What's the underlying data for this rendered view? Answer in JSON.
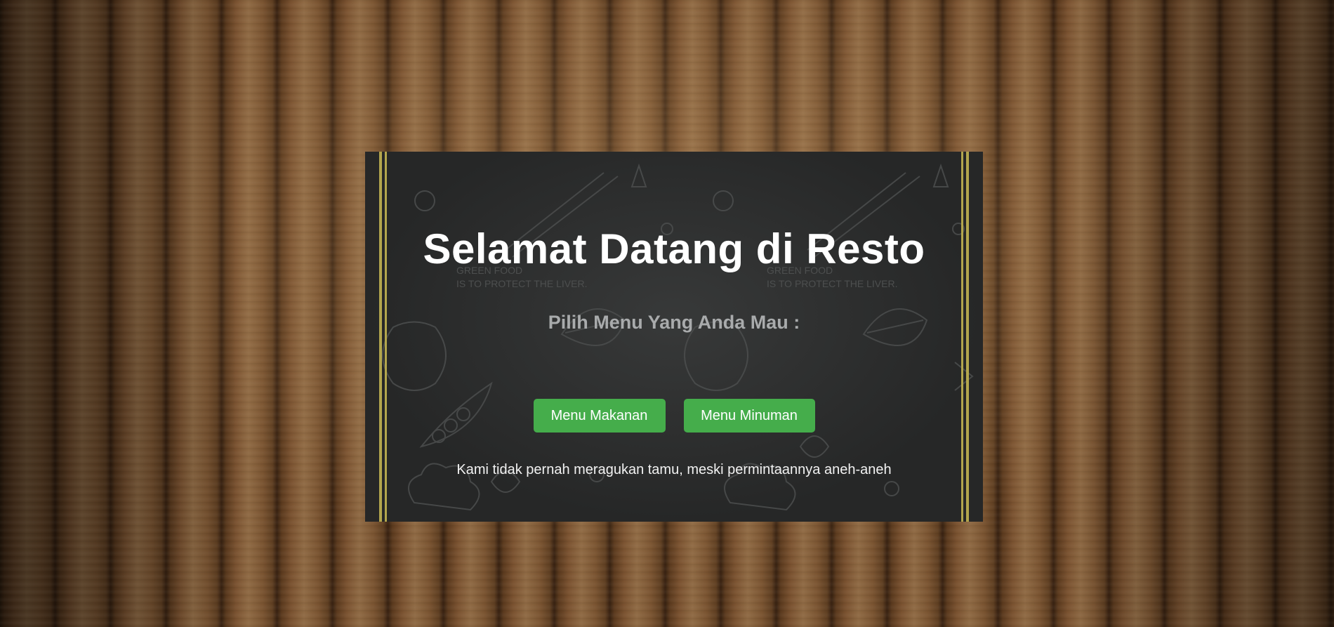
{
  "page": {
    "title": "Selamat Datang di Resto",
    "subtitle": "Pilih Menu Yang Anda Mau :",
    "tagline": "Kami tidak pernah meragukan tamu, meski permintaannya aneh-aneh"
  },
  "buttons": {
    "food_label": "Menu Makanan",
    "drink_label": "Menu Minuman"
  },
  "background": {
    "watermark_line1": "GREEN FOOD",
    "watermark_line2": "IS TO PROTECT THE LIVER."
  },
  "colors": {
    "button": "#45ad4b",
    "board": "#262727",
    "gold_border": "#b3a64d",
    "subtitle": "#a9abac",
    "wood": "#6b4a2b"
  }
}
